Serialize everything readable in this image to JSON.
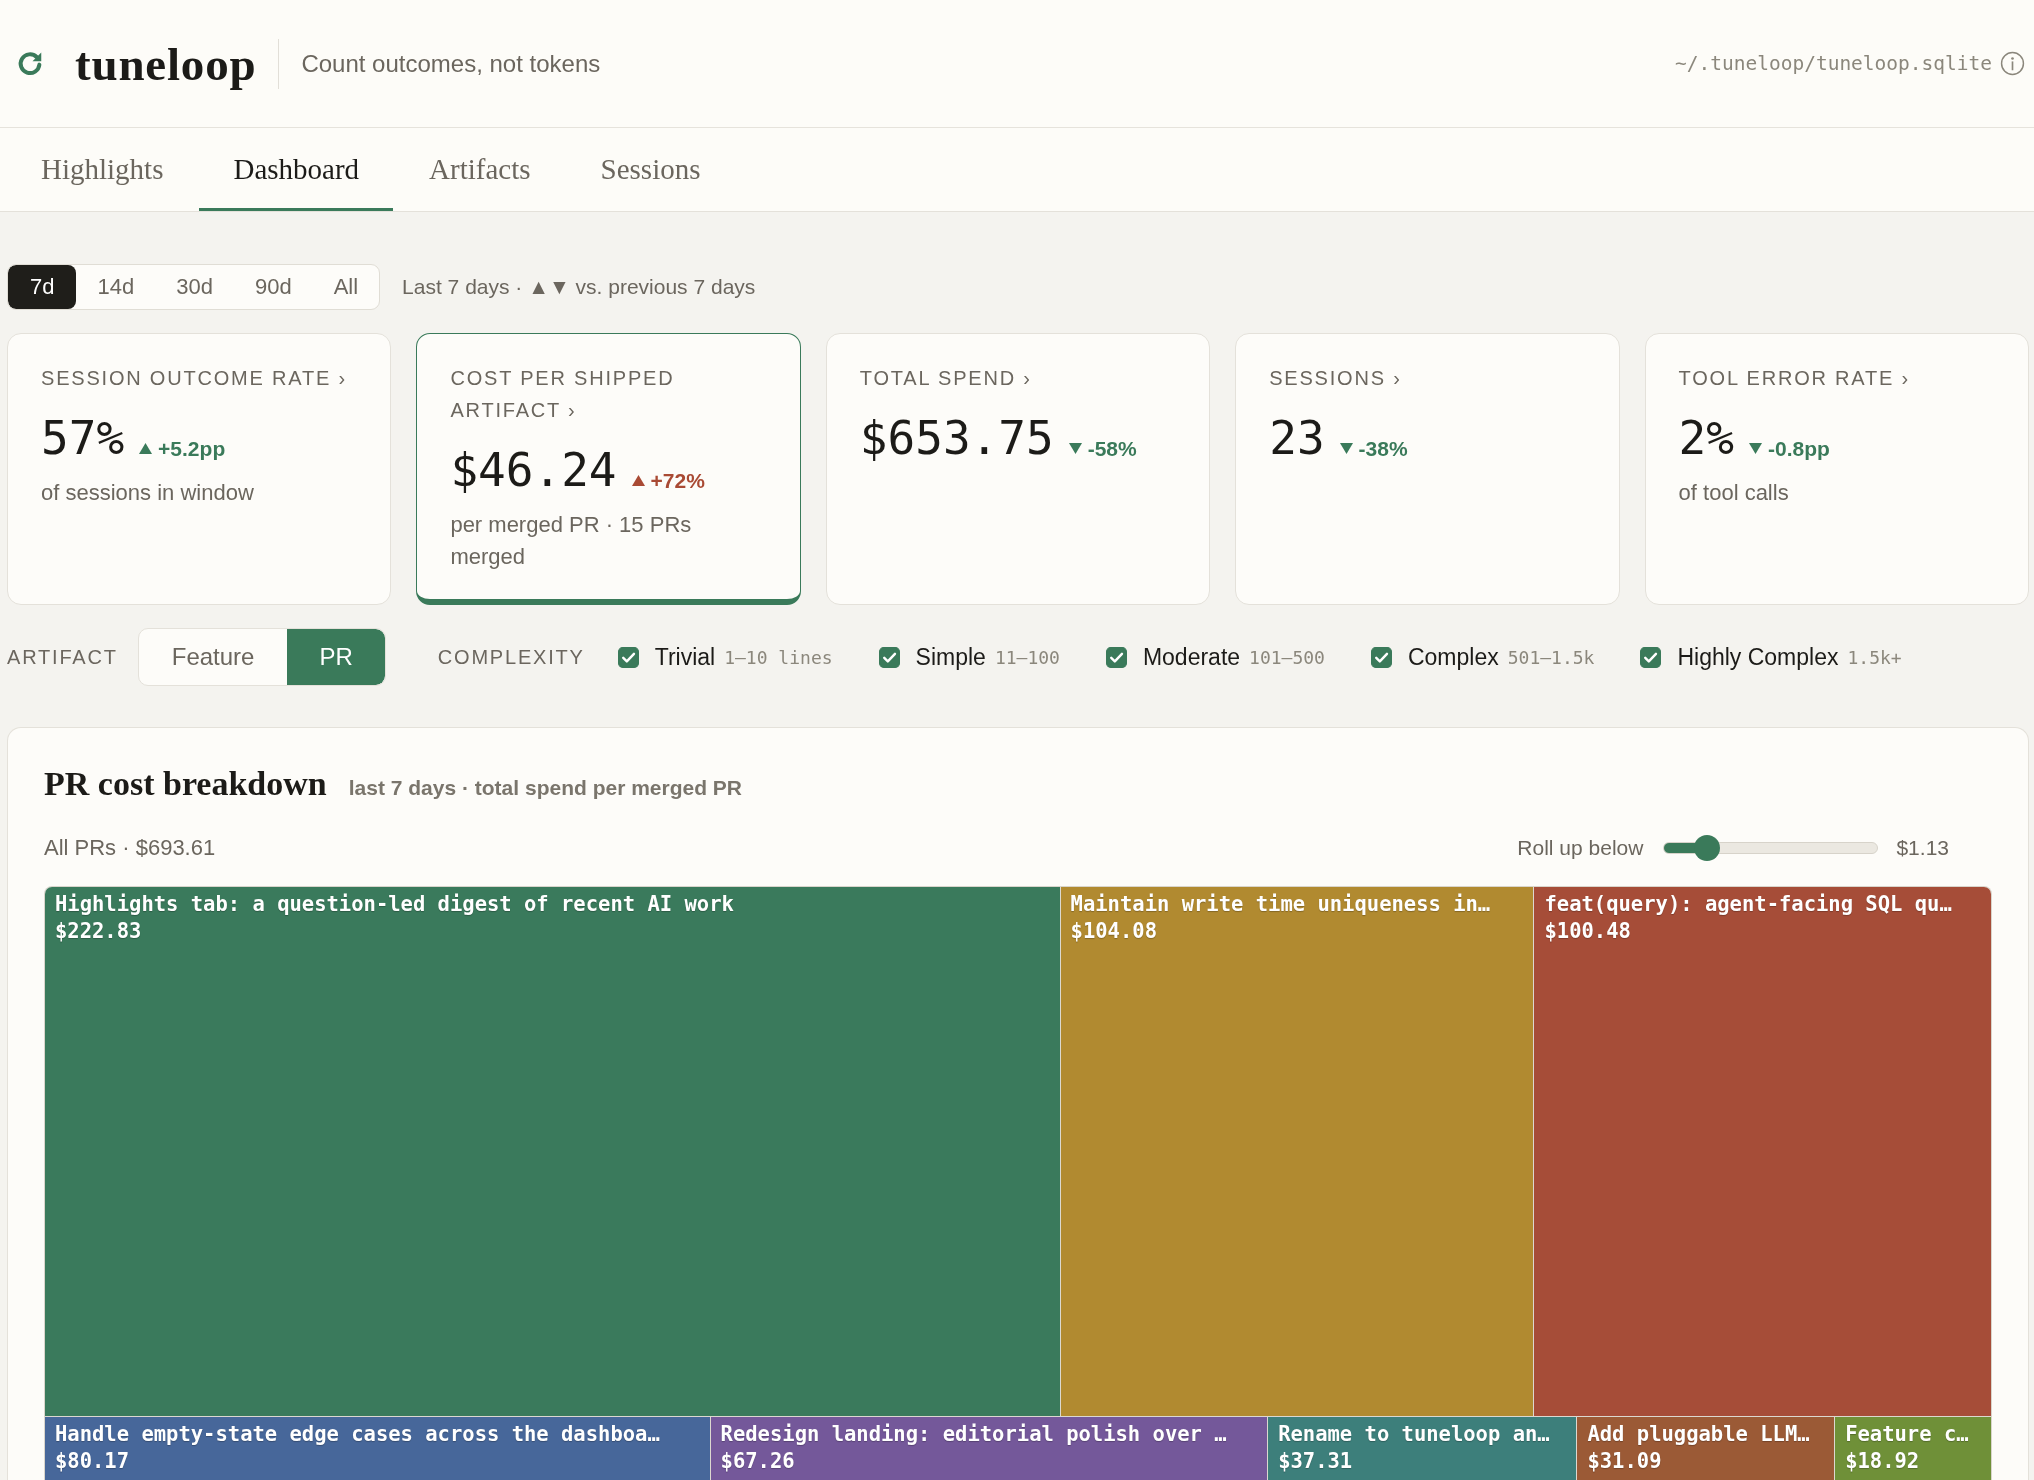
{
  "header": {
    "brand": "tuneloop",
    "tagline": "Count outcomes, not tokens",
    "db_path": "~/.tuneloop/tuneloop.sqlite"
  },
  "tabs": [
    {
      "label": "Highlights",
      "selected": false
    },
    {
      "label": "Dashboard",
      "selected": true
    },
    {
      "label": "Artifacts",
      "selected": false
    },
    {
      "label": "Sessions",
      "selected": false
    }
  ],
  "period": {
    "options": [
      {
        "label": "7d",
        "selected": true
      },
      {
        "label": "14d",
        "selected": false
      },
      {
        "label": "30d",
        "selected": false
      },
      {
        "label": "90d",
        "selected": false
      },
      {
        "label": "All",
        "selected": false
      }
    ],
    "caption": "Last 7 days · ▲▼ vs. previous 7 days"
  },
  "metrics": [
    {
      "label": "SESSION OUTCOME RATE ›",
      "value": "57%",
      "delta": {
        "text": "+5.2pp",
        "up": true,
        "adverse": false
      },
      "note": "of sessions in window",
      "selected": false
    },
    {
      "label": "COST PER SHIPPED ARTIFACT ›",
      "value": "$46.24",
      "delta": {
        "text": "+72%",
        "up": true,
        "adverse": true
      },
      "note": "per merged PR · 15 PRs merged",
      "selected": true
    },
    {
      "label": "TOTAL SPEND ›",
      "value": "$653.75",
      "delta": {
        "text": "-58%",
        "up": false,
        "adverse": false
      },
      "selected": false
    },
    {
      "label": "SESSIONS ›",
      "value": "23",
      "delta": {
        "text": "-38%",
        "up": false,
        "adverse": false
      },
      "selected": false
    },
    {
      "label": "TOOL ERROR RATE ›",
      "value": "2%",
      "delta": {
        "text": "-0.8pp",
        "up": false,
        "adverse": false
      },
      "note": "of tool calls",
      "selected": false
    }
  ],
  "filters": {
    "artifact": {
      "label": "ARTIFACT",
      "options": [
        {
          "label": "Feature",
          "selected": false
        },
        {
          "label": "PR",
          "selected": true
        }
      ]
    },
    "complexity": {
      "label": "COMPLEXITY",
      "items": [
        {
          "label": "Trivial",
          "range": "1–10 lines",
          "checked": true
        },
        {
          "label": "Simple",
          "range": "11–100",
          "checked": true
        },
        {
          "label": "Moderate",
          "range": "101–500",
          "checked": true
        },
        {
          "label": "Complex",
          "range": "501–1.5k",
          "checked": true
        },
        {
          "label": "Highly Complex",
          "range": "1.5k+",
          "checked": true
        }
      ]
    }
  },
  "breakdown": {
    "title": "PR cost breakdown",
    "subtitle": "last 7 days · total spend per merged PR",
    "total": "All PRs · $693.61",
    "rollup": {
      "label": "Roll up below",
      "level": 0.2,
      "value": "$1.13"
    },
    "treemap": {
      "bands": [
        {
          "tiles": [
            {
              "title": "Highlights tab: a question-led digest of recent AI work",
              "amount": "$222.83",
              "color": "#3a7a5c"
            },
            {
              "title": "Maintain write time uniqueness in…",
              "amount": "$104.08",
              "color": "#b18a30"
            },
            {
              "title": "feat(query): agent-facing SQL qu…",
              "amount": "$100.48",
              "color": "#a64d38"
            }
          ]
        },
        {
          "tiles": [
            {
              "title": "Handle empty-state edge cases across the dashboa…",
              "amount": "$80.17",
              "color": "#47679a"
            },
            {
              "title": "Redesign landing: editorial polish over …",
              "amount": "$67.26",
              "color": "#74589a"
            },
            {
              "title": "Rename to tuneloop an…",
              "amount": "$37.31",
              "color": "#3d7f7b"
            },
            {
              "title": "Add pluggable LLM…",
              "amount": "$31.09",
              "color": "#9b5a36"
            },
            {
              "title": "Feature c…",
              "amount": "$18.92",
              "color": "#6f9038"
            }
          ]
        }
      ]
    }
  }
}
